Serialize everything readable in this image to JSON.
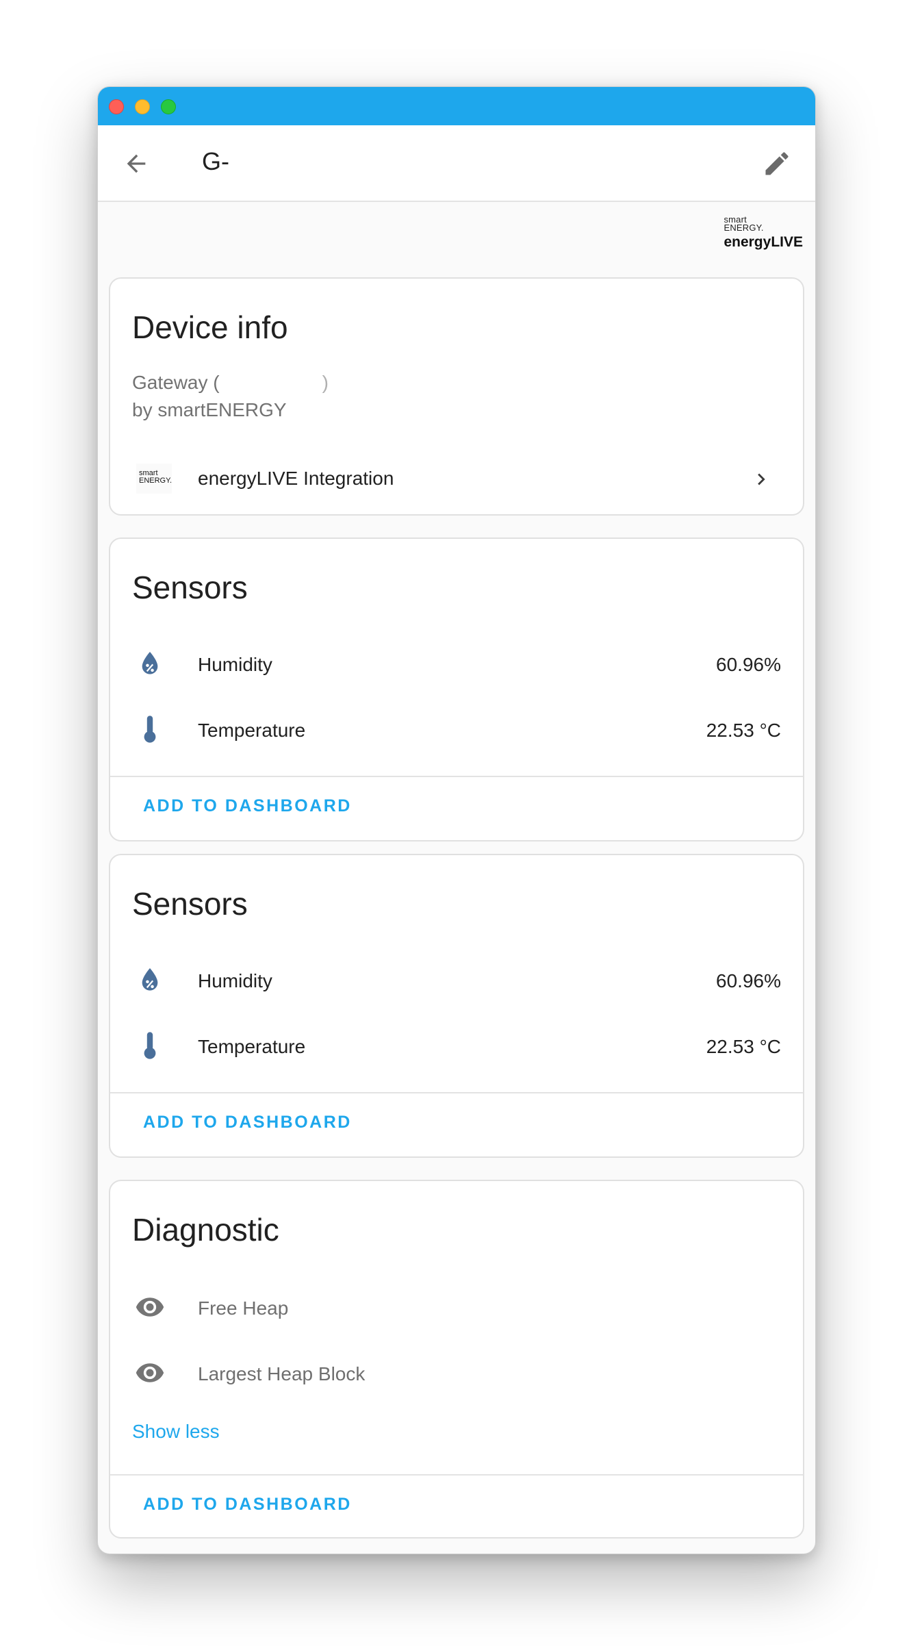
{
  "colors": {
    "accent": "#1ea7ec",
    "titlebar": "#1ea7ec",
    "sensor_icon": "#4a6f9a",
    "diag_icon": "#757575"
  },
  "window": {
    "title_text": "G-"
  },
  "brand": {
    "line1": "smart",
    "line2": "ENERGY.",
    "name": "energyLIVE"
  },
  "device_info": {
    "title": "Device info",
    "model_prefix": "Gateway (",
    "model_suffix": ")",
    "manufacturer": "by smartENERGY",
    "integration": {
      "logo_line1": "smart",
      "logo_line2": "ENERGY.",
      "label": "energyLIVE Integration",
      "icon": "chevron-right-icon"
    }
  },
  "sensors_1": {
    "title": "Sensors",
    "rows": [
      {
        "label": "Humidity",
        "value": "60.96%",
        "icon": "water-percent-icon"
      },
      {
        "label": "Temperature",
        "value": "22.53 °C",
        "icon": "thermometer-icon"
      }
    ],
    "action": "ADD TO DASHBOARD"
  },
  "sensors_2": {
    "title": "Sensors",
    "rows": [
      {
        "label": "Humidity",
        "value": "60.96%",
        "icon": "water-percent-icon"
      },
      {
        "label": "Temperature",
        "value": "22.53 °C",
        "icon": "thermometer-icon"
      }
    ],
    "action": "ADD TO DASHBOARD"
  },
  "diagnostic": {
    "title": "Diagnostic",
    "rows": [
      {
        "label": "Free Heap",
        "icon": "eye-icon"
      },
      {
        "label": "Largest Heap Block",
        "icon": "eye-icon"
      }
    ],
    "show_less": "Show less",
    "action": "ADD TO DASHBOARD"
  }
}
